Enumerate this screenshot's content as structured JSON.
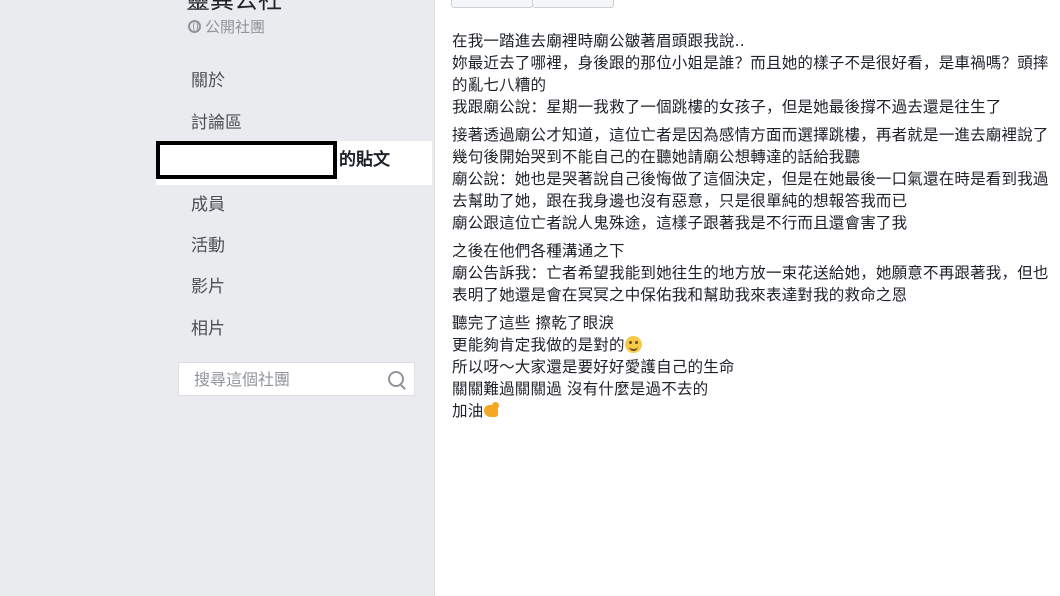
{
  "sidebar": {
    "group_title": "靈異公社",
    "privacy_label": "公開社團",
    "items": [
      {
        "label": "關於"
      },
      {
        "label": "討論區"
      },
      {
        "label": "的貼文"
      },
      {
        "label": "成員"
      },
      {
        "label": "活動"
      },
      {
        "label": "影片"
      },
      {
        "label": "相片"
      }
    ],
    "search_placeholder": "搜尋這個社團",
    "icons": {
      "privacy": "globe-icon",
      "search": "search-icon"
    }
  },
  "post": {
    "paragraphs": [
      [
        "在我一踏進去廟裡時廟公皺著眉頭跟我說..",
        "妳最近去了哪裡，身後跟的那位小姐是誰？而且她的樣子不是很好看，是車禍嗎？頭摔的亂七八糟的",
        "我跟廟公說：星期一我救了一個跳樓的女孩子，但是她最後撐不過去還是往生了"
      ],
      [
        "接著透過廟公才知道，這位亡者是因為感情方面而選擇跳樓，再者就是一進去廟裡說了幾句後開始哭到不能自己的在聽她請廟公想轉達的話給我聽",
        "廟公說：她也是哭著說自己後悔做了這個決定，但是在她最後一口氣還在時是看到我過去幫助了她，跟在我身邊也沒有惡意，只是很單純的想報答我而已",
        "廟公跟這位亡者說人鬼殊途，這樣子跟著我是不行而且還會害了我"
      ],
      [
        "之後在他們各種溝通之下",
        "廟公告訴我：亡者希望我能到她往生的地方放一束花送給她，她願意不再跟著我，但也表明了她還是會在冥冥之中保佑我和幫助我來表達對我的救命之恩"
      ],
      [
        "聽完了這些 擦乾了眼淚"
      ]
    ],
    "line_with_smile": "更能夠肯定我做的是對的",
    "closing_lines": [
      "所以呀～大家還是要好好愛護自己的生命",
      "關關難過關關過 沒有什麼是過不去的"
    ],
    "final_line": "加油",
    "emoji": {
      "smile": "smiling-face-emoji",
      "flex": "flexed-biceps-emoji"
    }
  }
}
